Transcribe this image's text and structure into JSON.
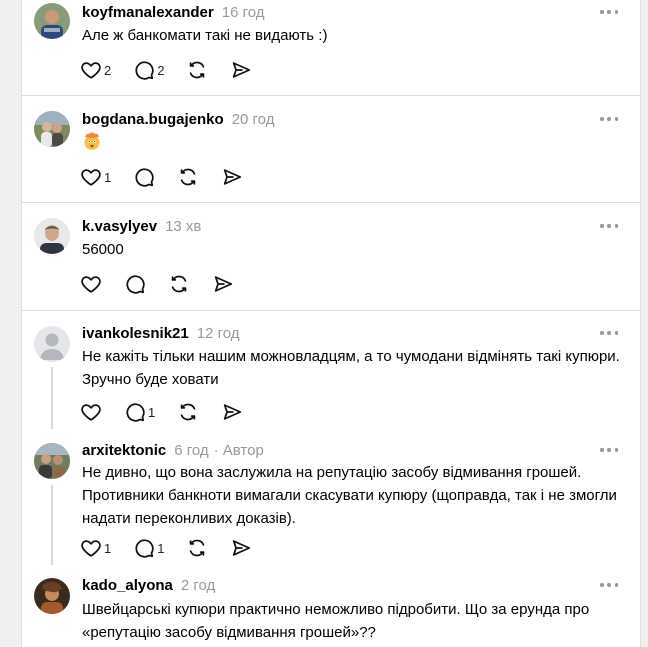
{
  "posts": [
    {
      "username": "koyfmanalexander",
      "time": "16 год",
      "text": "Але ж банкомати такі не видають :)",
      "likes": "2",
      "replies": "2"
    },
    {
      "username": "bogdana.bugajenko",
      "time": "20 год",
      "text": "",
      "emoji": "🤯",
      "likes": "1",
      "replies": ""
    },
    {
      "username": "k.vasylyev",
      "time": "13 хв",
      "text": "56000",
      "likes": "",
      "replies": ""
    },
    {
      "username": "ivankolesnik21",
      "time": "12 год",
      "text": "Не кажіть тільки нашим можновладцям, а то чумодани відмінять такі купюри. Зручно буде ховати",
      "likes": "",
      "replies": "1"
    },
    {
      "username": "arxitektonic",
      "time": "6 год",
      "author_badge": "· Автор",
      "text": "Не дивно, що вона заслужила на репутацію засобу відмивання грошей. Противники банкноти вимагали скасувати купюру (щоправда, так і не змогли надати переконливих доказів).",
      "likes": "1",
      "replies": "1"
    },
    {
      "username": "kado_alyona",
      "time": "2 год",
      "text": "Швейцарські купюри практично неможливо підробити. Що за ерунда про «репутацію засобу відмивання грошей»??"
    }
  ],
  "icons": {
    "like": "heart-icon",
    "reply": "comment-icon",
    "repost": "repost-icon",
    "share": "share-icon",
    "more": "more-options-icon"
  },
  "colors": {
    "text": "#000000",
    "muted": "#999999",
    "divider": "#dcdcdc"
  }
}
